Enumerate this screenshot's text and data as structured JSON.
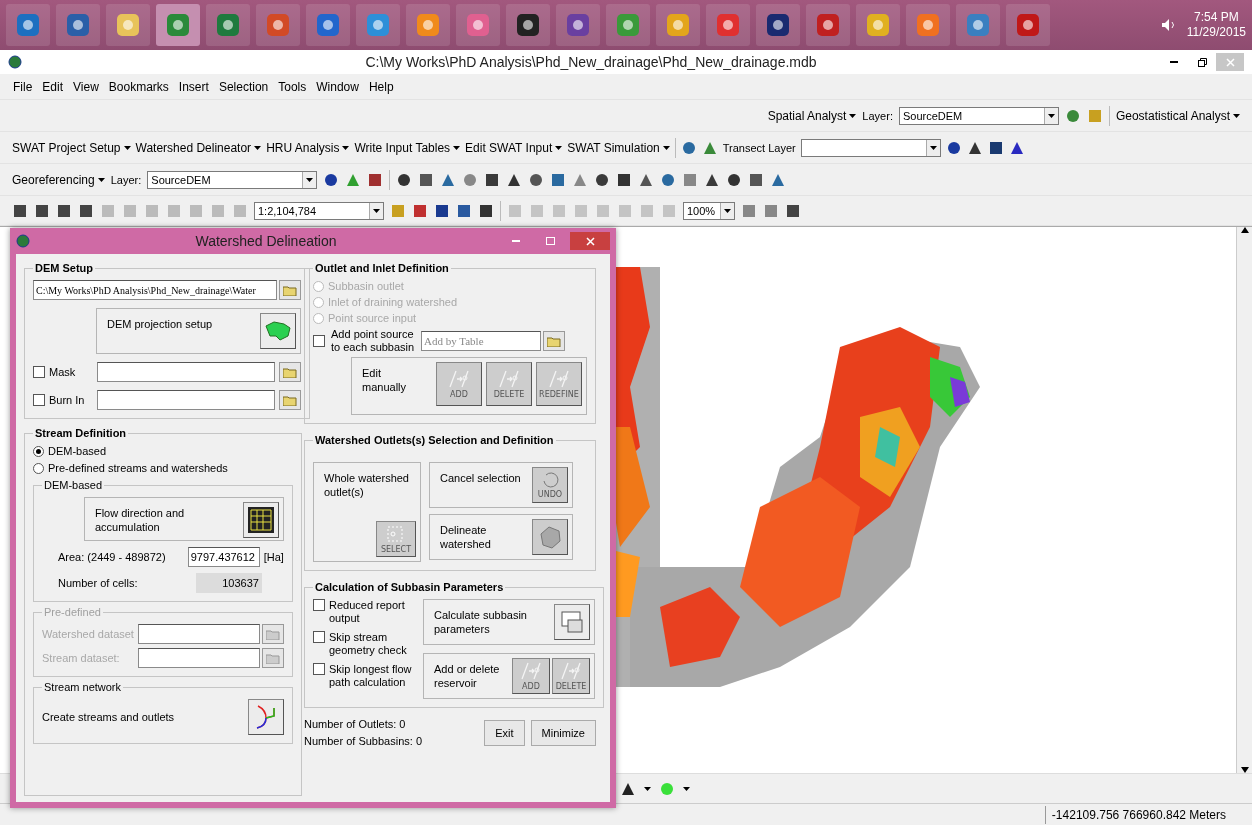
{
  "taskbar": {
    "time": "7:54 PM",
    "date": "11/29/2015"
  },
  "window": {
    "title": "C:\\My Works\\PhD Analysis\\Phd_New_drainage\\Phd_New_drainage.mdb"
  },
  "menu": [
    "File",
    "Edit",
    "View",
    "Bookmarks",
    "Insert",
    "Selection",
    "Tools",
    "Window",
    "Help"
  ],
  "spatial_toolbar": {
    "analyst": "Spatial Analyst",
    "layer_label": "Layer:",
    "layer": "SourceDEM",
    "geostat": "Geostatistical Analyst"
  },
  "swat_toolbar": {
    "menus": [
      "SWAT Project Setup",
      "Watershed Delineator",
      "HRU Analysis",
      "Write Input Tables",
      "Edit SWAT Input",
      "SWAT Simulation"
    ],
    "transect_label": "Transect Layer"
  },
  "georef_toolbar": {
    "menu": "Georeferencing",
    "layer_label": "Layer:",
    "layer": "SourceDEM"
  },
  "standard_toolbar": {
    "scale": "1:2,104,784",
    "zoom": "100%"
  },
  "dialog": {
    "title": "Watershed Delineation",
    "dem_setup": {
      "title": "DEM Setup",
      "path": "C:\\My Works\\PhD Analysis\\Phd_New_drainage\\Water",
      "projection_button": "DEM projection setup",
      "options": [
        {
          "label": "Mask",
          "checked": false
        },
        {
          "label": "Burn In",
          "checked": false
        }
      ]
    },
    "stream_definition": {
      "title": "Stream Definition",
      "modes": [
        {
          "label": "DEM-based",
          "selected": true
        },
        {
          "label": "Pre-defined streams and watersheds",
          "selected": false
        }
      ],
      "dem_based": {
        "title": "DEM-based",
        "flow_button": "Flow direction and accumulation",
        "area_label": "Area: (2449 - 489872)",
        "area_value": "9797.437612",
        "area_unit": "[Ha]",
        "cells_label": "Number of cells:",
        "cells_value": "103637"
      },
      "pre_defined": {
        "title": "Pre-defined",
        "disabled": true,
        "fields": [
          "Watershed dataset",
          "Stream dataset:"
        ]
      },
      "stream_network": {
        "title": "Stream network",
        "button": "Create streams and outlets"
      }
    },
    "outlet_inlet": {
      "title": "Outlet and Inlet Definition",
      "types": [
        {
          "label": "Subbasin outlet",
          "selected": false,
          "disabled": true
        },
        {
          "label": "Inlet of draining watershed",
          "selected": false,
          "disabled": true
        },
        {
          "label": "Point source input",
          "selected": false,
          "disabled": true
        }
      ],
      "point_source": {
        "label": "Add point source to each subbasin",
        "checked": false,
        "placeholder": "Add by Table"
      },
      "edit_label": "Edit manually",
      "edit_tools": [
        {
          "caption": "ADD",
          "disabled": true
        },
        {
          "caption": "DELETE",
          "disabled": true
        },
        {
          "caption": "REDEFINE",
          "disabled": true
        }
      ]
    },
    "outlets_selection": {
      "title": "Watershed Outlets(s) Selection and Definition",
      "whole": {
        "label": "Whole watershed outlet(s)",
        "caption": "SELECT",
        "disabled": true
      },
      "cancel": {
        "label": "Cancel selection",
        "caption": "UNDO",
        "disabled": true
      },
      "delineate": {
        "label": "Delineate watershed",
        "disabled": true
      }
    },
    "subbasin_params": {
      "title": "Calculation of Subbasin Parameters",
      "options": [
        {
          "label": "Reduced  report output",
          "checked": false
        },
        {
          "label": "Skip stream geometry check",
          "checked": false
        },
        {
          "label": "Skip longest flow path calculation",
          "checked": false
        }
      ],
      "calculate": "Calculate subbasin parameters",
      "reservoir": {
        "label": "Add or delete reservoir",
        "tools": [
          {
            "caption": "ADD",
            "disabled": true
          },
          {
            "caption": "DELETE",
            "disabled": true
          }
        ]
      }
    },
    "outlets_count": "Number of Outlets: 0",
    "subbasins_count": "Number of Subbasins: 0",
    "buttons": [
      "Exit",
      "Minimize"
    ]
  },
  "statusbar": {
    "coordinates": "-142109.756  766960.842 Meters"
  }
}
